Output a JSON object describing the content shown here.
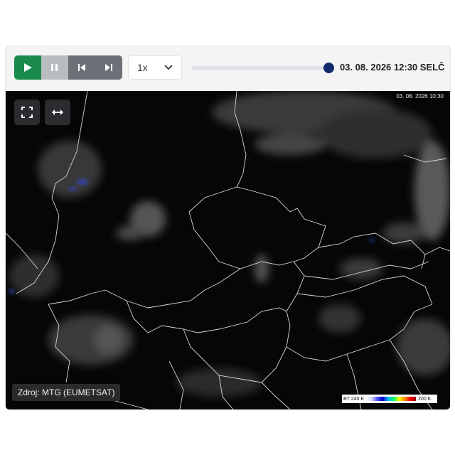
{
  "controls": {
    "play_icon": "play-icon",
    "pause_icon": "pause-icon",
    "prev_icon": "skip-back-icon",
    "next_icon": "skip-forward-icon",
    "speed_value": "1x",
    "speed_dropdown_icon": "chevron-down-icon",
    "timeline_position": 1.0,
    "timestamp": "03. 08. 2026 12:30 SELČ",
    "colors": {
      "play": "#1a8a4a",
      "thumb": "#102a6b"
    }
  },
  "map": {
    "stamp": "03. 08. 2026 10:30",
    "fullscreen_icon": "fullscreen-icon",
    "expand_icon": "horizontal-expand-icon",
    "source": "Zdroj: MTG (EUMETSAT)",
    "legend": {
      "min_label": "BT 240 K",
      "max_label": "200 K"
    }
  }
}
